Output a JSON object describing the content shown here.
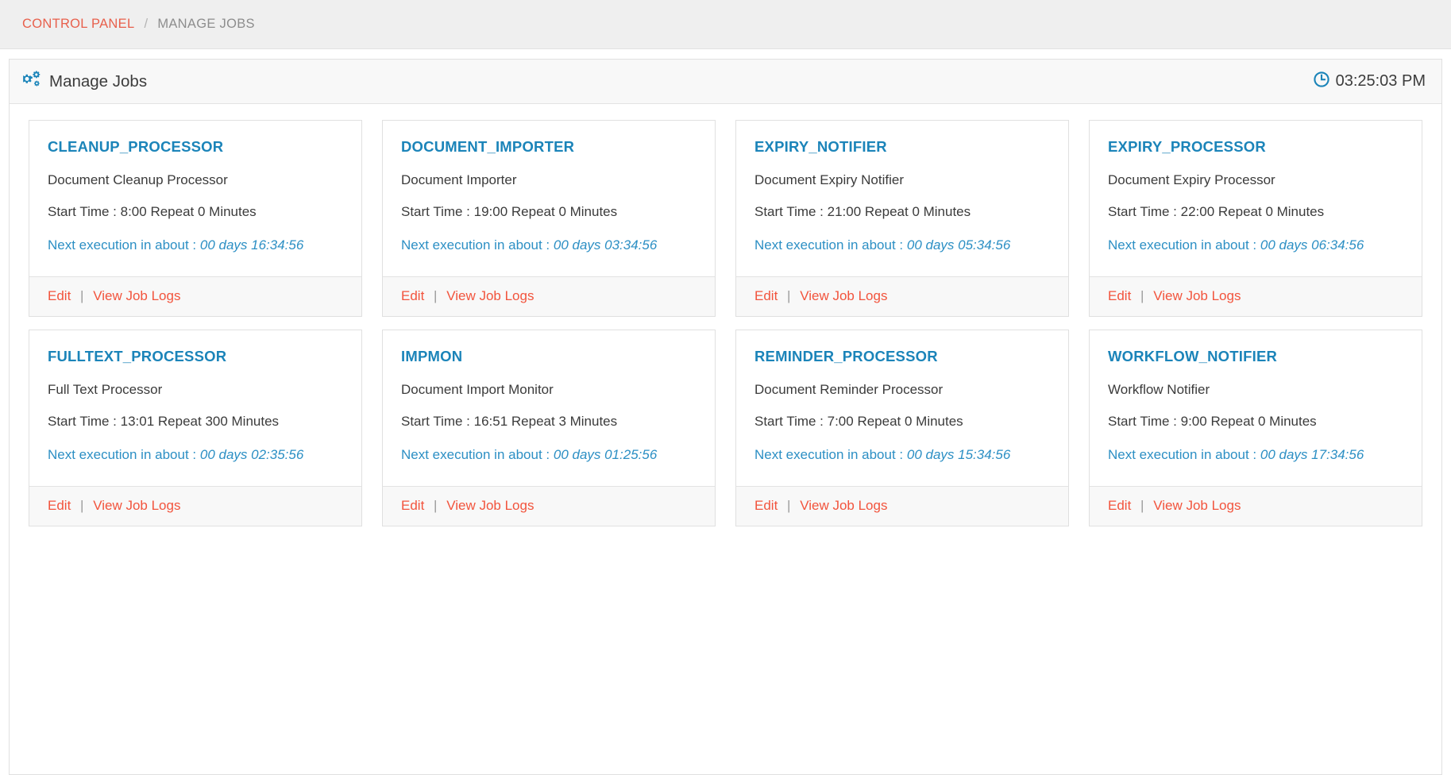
{
  "breadcrumb": {
    "root_label": "CONTROL PANEL",
    "separator": "/",
    "current_label": "MANAGE JOBS"
  },
  "panel": {
    "title": "Manage Jobs",
    "title_icon": "cogs-icon",
    "clock_icon": "clock-icon",
    "clock_time": "03:25:03 PM",
    "accent_blue": "#1b84b9",
    "link_red": "#f2543d",
    "crumb_red": "#e8604c"
  },
  "labels": {
    "edit": "Edit",
    "view_job_logs": "View Job Logs",
    "link_separator": "|"
  },
  "jobs": [
    {
      "name": "CLEANUP_PROCESSOR",
      "description": "Document Cleanup Processor",
      "schedule": "Start Time : 8:00 Repeat 0 Minutes",
      "next_label": "Next execution in about :",
      "next_value": "00 days 16:34:56"
    },
    {
      "name": "DOCUMENT_IMPORTER",
      "description": "Document Importer",
      "schedule": "Start Time : 19:00 Repeat 0 Minutes",
      "next_label": "Next execution in about :",
      "next_value": "00 days 03:34:56"
    },
    {
      "name": "EXPIRY_NOTIFIER",
      "description": "Document Expiry Notifier",
      "schedule": "Start Time : 21:00 Repeat 0 Minutes",
      "next_label": "Next execution in about :",
      "next_value": "00 days 05:34:56"
    },
    {
      "name": "EXPIRY_PROCESSOR",
      "description": "Document Expiry Processor",
      "schedule": "Start Time : 22:00 Repeat 0 Minutes",
      "next_label": "Next execution in about :",
      "next_value": "00 days 06:34:56"
    },
    {
      "name": "FULLTEXT_PROCESSOR",
      "description": "Full Text Processor",
      "schedule": "Start Time : 13:01 Repeat 300 Minutes",
      "next_label": "Next execution in about :",
      "next_value": "00 days 02:35:56"
    },
    {
      "name": "IMPMON",
      "description": "Document Import Monitor",
      "schedule": "Start Time : 16:51 Repeat 3 Minutes",
      "next_label": "Next execution in about :",
      "next_value": "00 days 01:25:56"
    },
    {
      "name": "REMINDER_PROCESSOR",
      "description": "Document Reminder Processor",
      "schedule": "Start Time : 7:00 Repeat 0 Minutes",
      "next_label": "Next execution in about :",
      "next_value": "00 days 15:34:56"
    },
    {
      "name": "WORKFLOW_NOTIFIER",
      "description": "Workflow Notifier",
      "schedule": "Start Time : 9:00 Repeat 0 Minutes",
      "next_label": "Next execution in about :",
      "next_value": "00 days 17:34:56"
    }
  ]
}
